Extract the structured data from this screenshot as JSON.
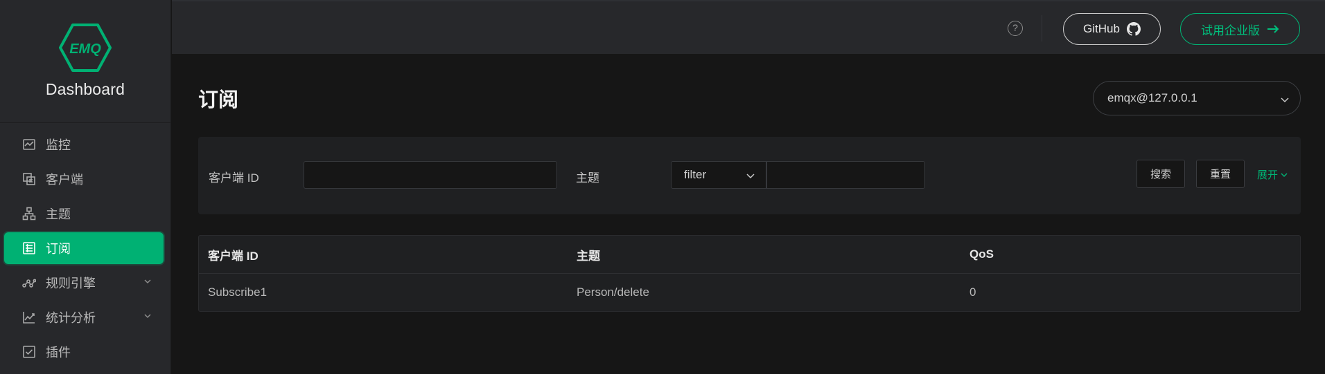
{
  "brand": {
    "logo_text": "EMQ",
    "app_name": "Dashboard",
    "accent_color": "#00b173"
  },
  "sidebar": {
    "items": [
      {
        "label": "监控",
        "icon": "monitor-icon",
        "active": false,
        "has_submenu": false
      },
      {
        "label": "客户端",
        "icon": "clients-icon",
        "active": false,
        "has_submenu": false
      },
      {
        "label": "主题",
        "icon": "topics-icon",
        "active": false,
        "has_submenu": false
      },
      {
        "label": "订阅",
        "icon": "subscriptions-icon",
        "active": true,
        "has_submenu": false
      },
      {
        "label": "规则引擎",
        "icon": "rule-engine-icon",
        "active": false,
        "has_submenu": true
      },
      {
        "label": "统计分析",
        "icon": "analytics-icon",
        "active": false,
        "has_submenu": true
      },
      {
        "label": "插件",
        "icon": "plugins-icon",
        "active": false,
        "has_submenu": false
      }
    ]
  },
  "topbar": {
    "help_icon": "question-circle-icon",
    "github_label": "GitHub",
    "enterprise_label": "试用企业版"
  },
  "main": {
    "title": "订阅",
    "node_select": {
      "value": "emqx@127.0.0.1"
    },
    "filters": {
      "client_id_label": "客户端 ID",
      "client_id_value": "",
      "topic_label": "主题",
      "topic_match_value": "filter",
      "topic_value": "",
      "search_label": "搜索",
      "reset_label": "重置",
      "expand_label": "展开"
    },
    "table": {
      "columns": [
        "客户端 ID",
        "主题",
        "QoS"
      ],
      "rows": [
        [
          "Subscribe1",
          "Person/delete",
          "0"
        ]
      ]
    }
  }
}
